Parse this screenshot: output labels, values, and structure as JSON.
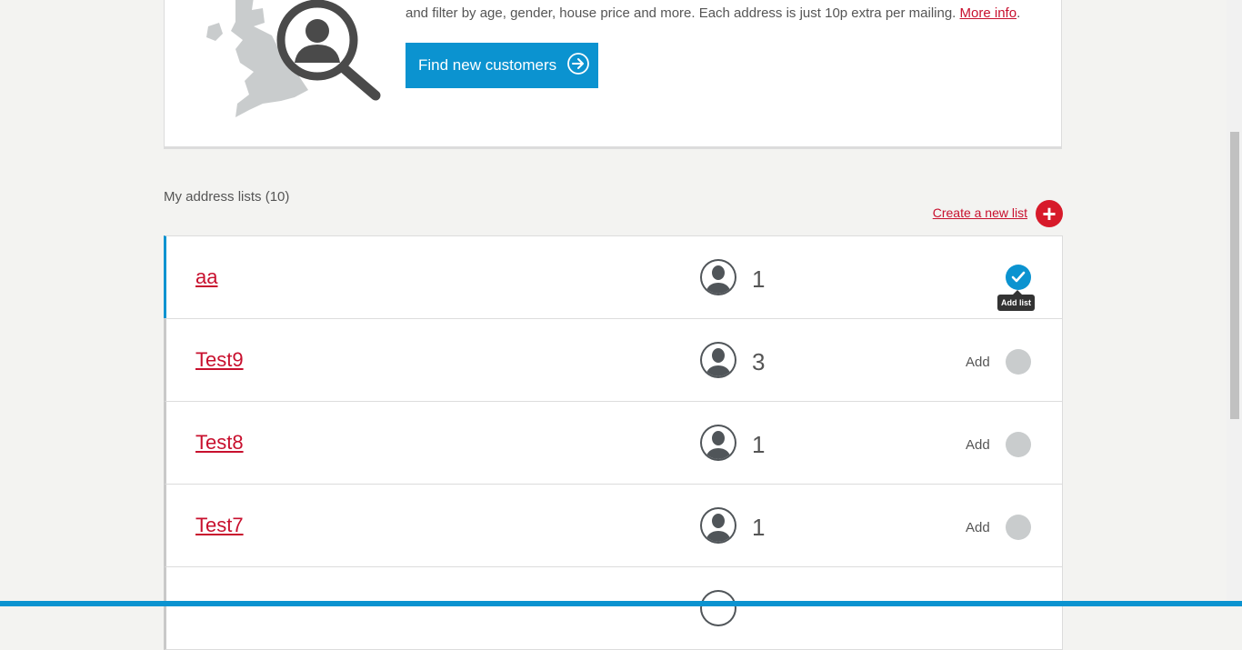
{
  "promo": {
    "text": "and filter by age, gender, house price and more. Each address is just 10p extra per mailing.",
    "more_info": "More info",
    "trailing": ".",
    "button_label": "Find new customers"
  },
  "section": {
    "title": "My address lists (10)",
    "create_link": "Create a new list",
    "plus_symbol": "+"
  },
  "lists": [
    {
      "name": "aa",
      "count": "1",
      "add_label": "",
      "selected": true
    },
    {
      "name": "Test9",
      "count": "3",
      "add_label": "Add",
      "selected": false
    },
    {
      "name": "Test8",
      "count": "1",
      "add_label": "Add",
      "selected": false
    },
    {
      "name": "Test7",
      "count": "1",
      "add_label": "Add",
      "selected": false
    }
  ],
  "tooltip": "Add list",
  "colors": {
    "accent": "#0b93d0",
    "link": "#c8102e",
    "plus": "#d71a2a",
    "toggle_off": "#c9cccd"
  }
}
